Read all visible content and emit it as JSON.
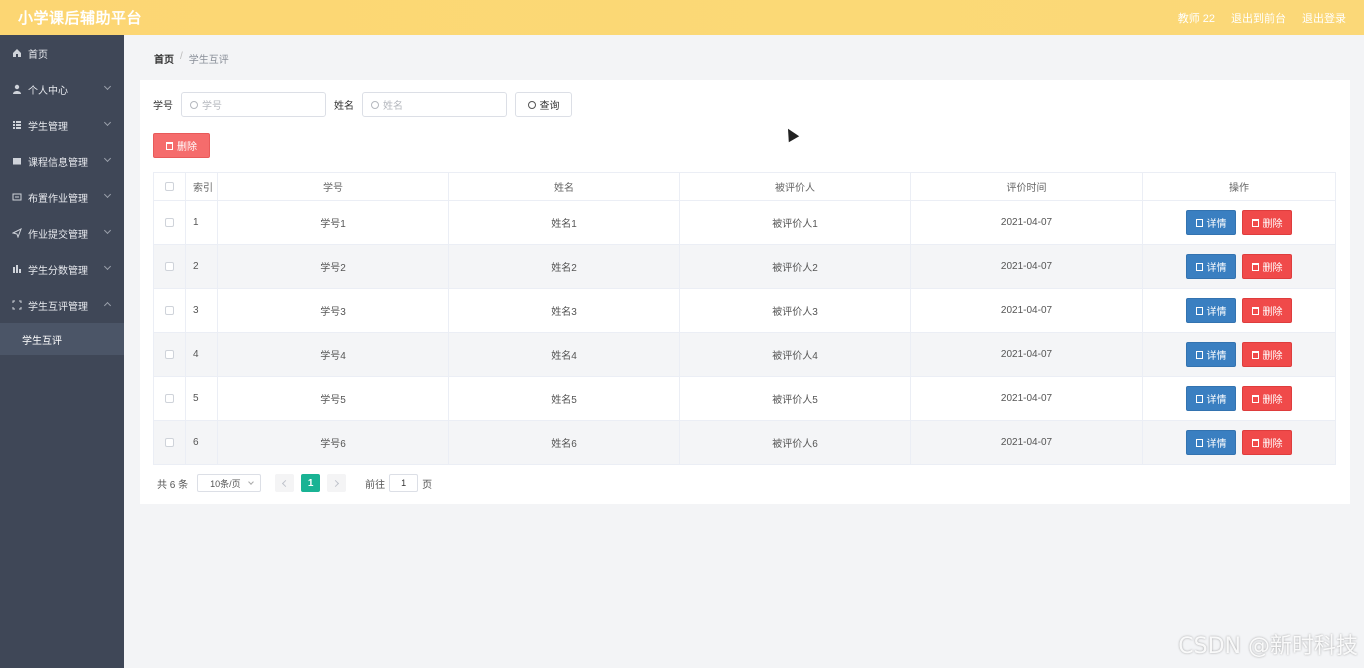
{
  "header": {
    "title": "小学课后辅助平台",
    "user": "教师 22",
    "to_front": "退出到前台",
    "logout": "退出登录"
  },
  "sidebar": {
    "items": [
      {
        "label": "首页",
        "icon": "home-icon"
      },
      {
        "label": "个人中心",
        "icon": "user-icon"
      },
      {
        "label": "学生管理",
        "icon": "grid-icon"
      },
      {
        "label": "课程信息管理",
        "icon": "book-icon"
      },
      {
        "label": "布置作业管理",
        "icon": "message-icon"
      },
      {
        "label": "作业提交管理",
        "icon": "send-icon"
      },
      {
        "label": "学生分数管理",
        "icon": "chart-icon"
      },
      {
        "label": "学生互评管理",
        "icon": "frame-icon"
      }
    ],
    "sub_item": "学生互评"
  },
  "breadcrumb": {
    "home": "首页",
    "sep": "/",
    "current": "学生互评"
  },
  "search": {
    "label_id": "学号",
    "placeholder_id": "学号",
    "label_name": "姓名",
    "placeholder_name": "姓名",
    "query_button": "查询"
  },
  "bulk_delete": "删除",
  "table": {
    "columns": [
      "索引",
      "学号",
      "姓名",
      "被评价人",
      "评价时间",
      "操作"
    ],
    "rows": [
      {
        "idx": "1",
        "sid": "学号1",
        "name": "姓名1",
        "target": "被评价人1",
        "time": "2021-04-07"
      },
      {
        "idx": "2",
        "sid": "学号2",
        "name": "姓名2",
        "target": "被评价人2",
        "time": "2021-04-07"
      },
      {
        "idx": "3",
        "sid": "学号3",
        "name": "姓名3",
        "target": "被评价人3",
        "time": "2021-04-07"
      },
      {
        "idx": "4",
        "sid": "学号4",
        "name": "姓名4",
        "target": "被评价人4",
        "time": "2021-04-07"
      },
      {
        "idx": "5",
        "sid": "学号5",
        "name": "姓名5",
        "target": "被评价人5",
        "time": "2021-04-07"
      },
      {
        "idx": "6",
        "sid": "学号6",
        "name": "姓名6",
        "target": "被评价人6",
        "time": "2021-04-07"
      }
    ],
    "detail_label": "详情",
    "delete_label": "删除"
  },
  "pagination": {
    "total": "共 6 条",
    "page_size": "10条/页",
    "current_page": "1",
    "goto_prefix": "前往",
    "goto_value": "1",
    "goto_suffix": "页"
  },
  "watermark": "CSDN @新时科技",
  "colors": {
    "header": "#fcd673",
    "sidebar": "#3f4757",
    "detail_button": "#3a7fc1",
    "delete_button": "#f04a4a",
    "active_page": "#19b394"
  }
}
